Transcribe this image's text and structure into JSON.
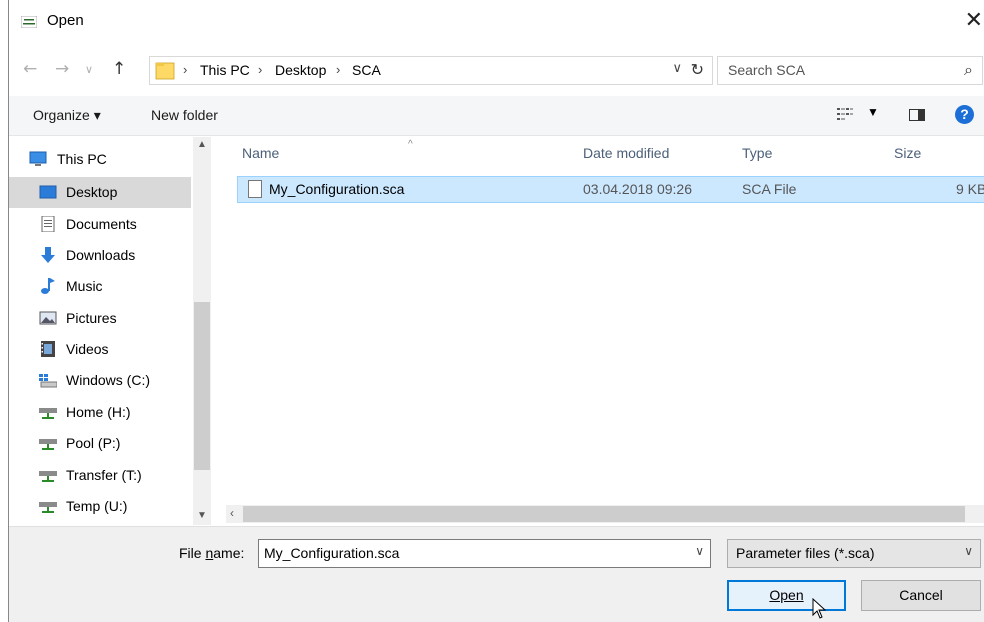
{
  "titlebar": {
    "title": "Open",
    "close_glyph": "✕"
  },
  "address": {
    "crumbs": [
      "This PC",
      "Desktop",
      "SCA"
    ],
    "search_placeholder": "Search SCA"
  },
  "toolbar": {
    "organize": "Organize ▾",
    "new_folder": "New folder"
  },
  "nav": {
    "items": [
      {
        "label": "This PC",
        "icon": "computer-icon"
      },
      {
        "label": "Desktop",
        "icon": "desktop-icon",
        "selected": true
      },
      {
        "label": "Documents",
        "icon": "documents-icon"
      },
      {
        "label": "Downloads",
        "icon": "downloads-icon"
      },
      {
        "label": "Music",
        "icon": "music-icon"
      },
      {
        "label": "Pictures",
        "icon": "pictures-icon"
      },
      {
        "label": "Videos",
        "icon": "videos-icon"
      },
      {
        "label": "Windows (C:)",
        "icon": "drive-icon"
      },
      {
        "label": "Home (H:)",
        "icon": "network-drive-icon"
      },
      {
        "label": "Pool (P:)",
        "icon": "network-drive-icon"
      },
      {
        "label": "Transfer (T:)",
        "icon": "network-drive-icon"
      },
      {
        "label": "Temp (U:)",
        "icon": "network-drive-icon"
      }
    ]
  },
  "files": {
    "columns": [
      "Name",
      "Date modified",
      "Type",
      "Size"
    ],
    "rows": [
      {
        "name": "My_Configuration.sca",
        "date": "03.04.2018 09:26",
        "type": "SCA File",
        "size": "9 KB",
        "selected": true
      }
    ]
  },
  "bottom": {
    "filename_label_pre": "File ",
    "filename_label_u": "n",
    "filename_label_post": "ame:",
    "filename_value": "My_Configuration.sca",
    "filter": "Parameter files (*.sca)",
    "open": "Open",
    "cancel": "Cancel"
  },
  "colors": {
    "accent": "#0078d7",
    "selection": "#cce8ff",
    "help": "#1c6fd6"
  }
}
